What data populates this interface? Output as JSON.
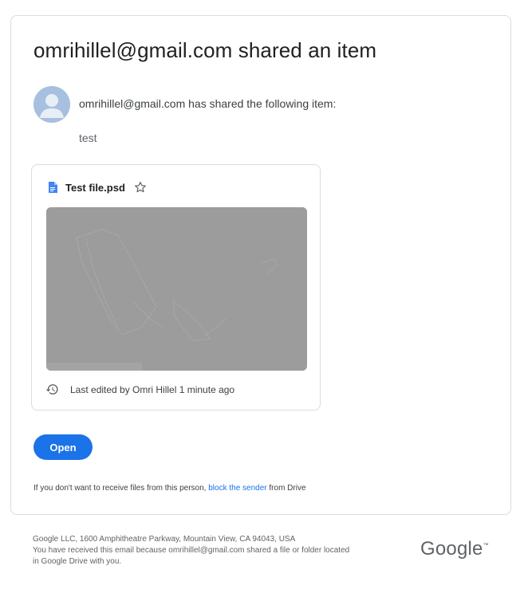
{
  "email": {
    "title": "omrihillel@gmail.com shared an item",
    "shared_line": "omrihillel@gmail.com has shared the following item:",
    "message": "test"
  },
  "file_card": {
    "file_name": "Test file.psd",
    "file_icon": "document-icon",
    "star_icon": "star-icon",
    "history_icon": "history-icon",
    "last_edited": "Last edited by Omri Hillel 1 minute ago"
  },
  "actions": {
    "open_label": "Open"
  },
  "block_notice": {
    "prefix": "If you don't want to receive files from this person, ",
    "link_text": "block the sender",
    "suffix": " from Drive"
  },
  "footer": {
    "address": "Google LLC, 1600 Amphitheatre Parkway, Mountain View, CA 94043, USA",
    "reason_line1": "You have received this email because omrihillel@gmail.com shared a file or folder located",
    "reason_line2": "in Google Drive with you.",
    "logo_text": "Google",
    "logo_tm": "™"
  },
  "colors": {
    "accent": "#1a73e8",
    "preview_gray": "#9c9c9c",
    "border": "#dadce0"
  }
}
